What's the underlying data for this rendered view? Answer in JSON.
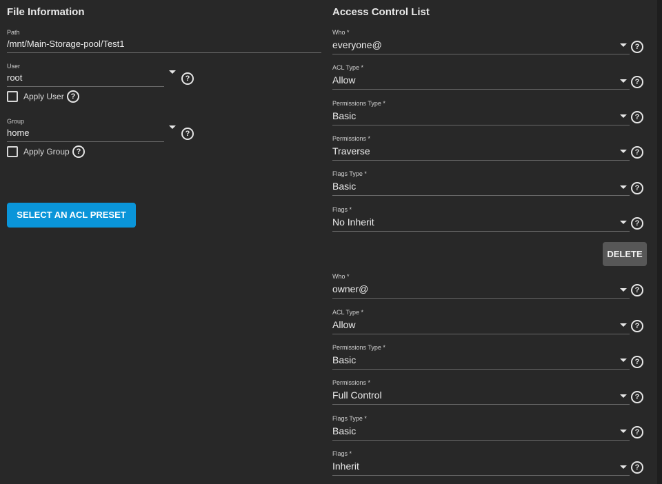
{
  "file_info": {
    "title": "File Information",
    "path": {
      "label": "Path",
      "value": "/mnt/Main-Storage-pool/Test1"
    },
    "user": {
      "label": "User",
      "value": "root",
      "apply_label": "Apply User"
    },
    "group": {
      "label": "Group",
      "value": "home",
      "apply_label": "Apply Group"
    },
    "preset_button": "SELECT AN ACL PRESET"
  },
  "acl": {
    "title": "Access Control List",
    "entries": [
      {
        "who": {
          "label": "Who *",
          "value": "everyone@"
        },
        "acl_type": {
          "label": "ACL Type *",
          "value": "Allow"
        },
        "permissions_type": {
          "label": "Permissions Type *",
          "value": "Basic"
        },
        "permissions": {
          "label": "Permissions *",
          "value": "Traverse"
        },
        "flags_type": {
          "label": "Flags Type *",
          "value": "Basic"
        },
        "flags": {
          "label": "Flags *",
          "value": "No Inherit"
        },
        "delete_label": "DELETE"
      },
      {
        "who": {
          "label": "Who *",
          "value": "owner@"
        },
        "acl_type": {
          "label": "ACL Type *",
          "value": "Allow"
        },
        "permissions_type": {
          "label": "Permissions Type *",
          "value": "Basic"
        },
        "permissions": {
          "label": "Permissions *",
          "value": "Full Control"
        },
        "flags_type": {
          "label": "Flags Type *",
          "value": "Basic"
        },
        "flags": {
          "label": "Flags *",
          "value": "Inherit"
        }
      }
    ]
  },
  "help_glyph": "?",
  "colors": {
    "background": "#282828",
    "primary_button": "#0a95d9",
    "delete_button": "#575757"
  }
}
